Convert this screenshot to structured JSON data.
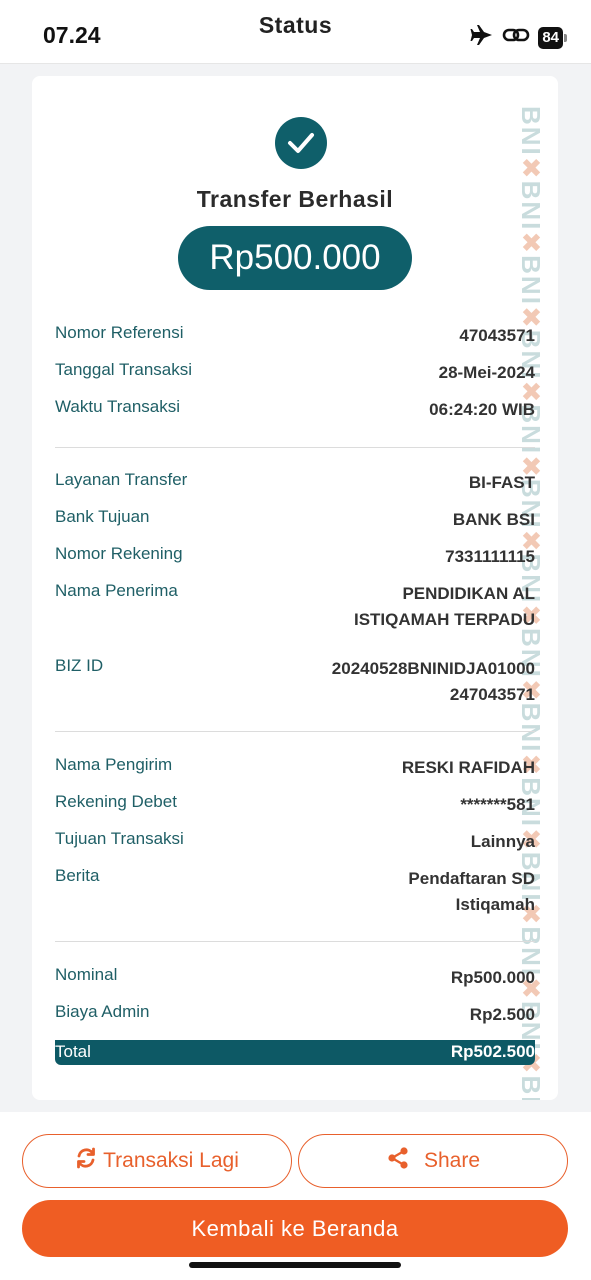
{
  "status_bar": {
    "time": "07.24",
    "title": "Status",
    "battery": "84"
  },
  "receipt": {
    "title": "Transfer Berhasil",
    "amount": "Rp500.000",
    "watermark": "BNI",
    "reference": {
      "label": "Nomor Referensi",
      "value": "47043571"
    },
    "date": {
      "label": "Tanggal Transaksi",
      "value": "28-Mei-2024"
    },
    "time": {
      "label": "Waktu Transaksi",
      "value": "06:24:20 WIB"
    },
    "service": {
      "label": "Layanan Transfer",
      "value": "BI-FAST"
    },
    "bank": {
      "label": "Bank Tujuan",
      "value": "BANK BSI"
    },
    "account": {
      "label": "Nomor Rekening",
      "value": "7331111115"
    },
    "recipient": {
      "label": "Nama Penerima",
      "value_line1": "PENDIDIKAN AL",
      "value_line2": "ISTIQAMAH TERPADU"
    },
    "biz_id": {
      "label": "BIZ ID",
      "value_line1": "20240528BNINIDJA01000",
      "value_line2": "247043571"
    },
    "sender": {
      "label": "Nama Pengirim",
      "value": "RESKI RAFIDAH"
    },
    "debit_account": {
      "label": "Rekening Debet",
      "value": "*******581"
    },
    "purpose": {
      "label": "Tujuan Transaksi",
      "value": "Lainnya"
    },
    "note": {
      "label": "Berita",
      "value_line1": "Pendaftaran SD",
      "value_line2": "Istiqamah"
    },
    "nominal": {
      "label": "Nominal",
      "value": "Rp500.000"
    },
    "admin_fee": {
      "label": "Biaya Admin",
      "value": "Rp2.500"
    },
    "total": {
      "label": "Total",
      "value": "Rp502.500"
    }
  },
  "actions": {
    "again_label": "Transaksi Lagi",
    "share_label": "Share",
    "home_label": "Kembali ke Beranda"
  },
  "colors": {
    "primary_teal": "#0f5f6a",
    "accent_orange": "#ef5d23"
  },
  "icons": [
    "airplane-icon",
    "link-icon",
    "battery-icon",
    "check-icon",
    "refresh-icon",
    "share-icon"
  ]
}
